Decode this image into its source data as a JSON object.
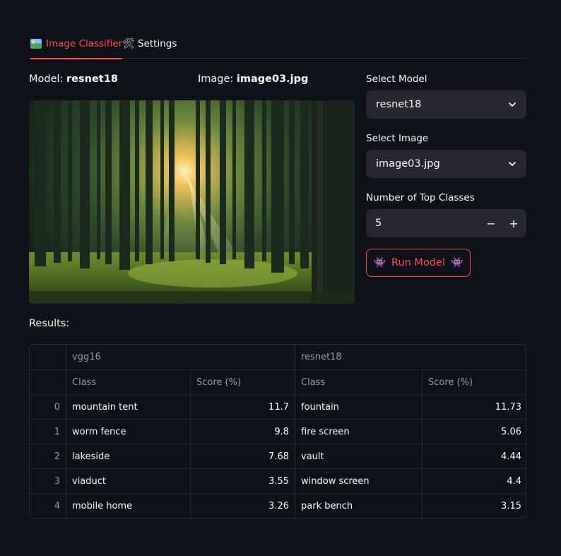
{
  "tabs": [
    {
      "label": "Image Classifier",
      "icon": "landscape-icon",
      "active": true
    },
    {
      "label": "Settings",
      "icon": "tools-icon",
      "active": false
    }
  ],
  "captions": {
    "model_label": "Model:",
    "model_value": "resnet18",
    "image_label": "Image:",
    "image_value": "image03.jpg"
  },
  "controls": {
    "select_model_label": "Select Model",
    "select_model_value": "resnet18",
    "select_image_label": "Select Image",
    "select_image_value": "image03.jpg",
    "top_classes_label": "Number of Top Classes",
    "top_classes_value": "5",
    "minus": "−",
    "plus": "+",
    "run_label": "Run Model",
    "run_icon": "👾"
  },
  "results": {
    "title": "Results:",
    "groups": [
      "vgg16",
      "resnet18"
    ],
    "columns": [
      "Class",
      "Score (%)",
      "Class",
      "Score (%)"
    ],
    "rows": [
      {
        "index": "0",
        "c1": "mountain tent",
        "s1": "11.7",
        "c2": "fountain",
        "s2": "11.73"
      },
      {
        "index": "1",
        "c1": "worm fence",
        "s1": "9.8",
        "c2": "fire screen",
        "s2": "5.06"
      },
      {
        "index": "2",
        "c1": "lakeside",
        "s1": "7.68",
        "c2": "vault",
        "s2": "4.44"
      },
      {
        "index": "3",
        "c1": "viaduct",
        "s1": "3.55",
        "c2": "window screen",
        "s2": "4.4"
      },
      {
        "index": "4",
        "c1": "mobile home",
        "s1": "3.26",
        "c2": "park bench",
        "s2": "3.15"
      }
    ]
  },
  "colors": {
    "background": "#0e1117",
    "accent": "#ff4b4b",
    "input_bg": "#262730"
  }
}
